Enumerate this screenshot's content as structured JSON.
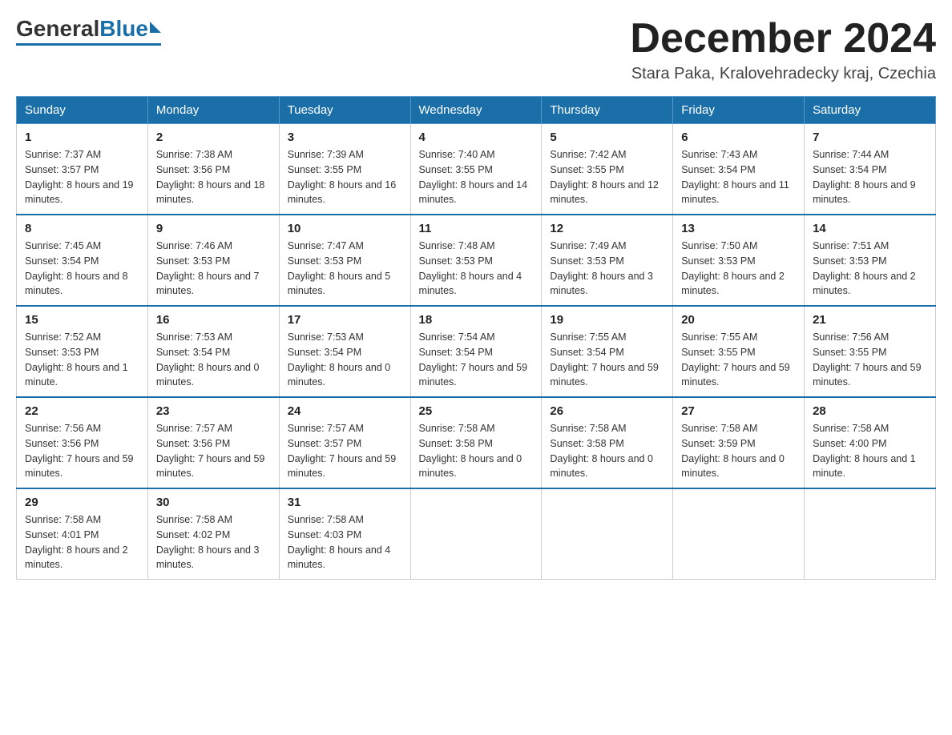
{
  "logo": {
    "general": "General",
    "blue": "Blue"
  },
  "title": {
    "month_year": "December 2024",
    "location": "Stara Paka, Kralovehradecky kraj, Czechia"
  },
  "headers": [
    "Sunday",
    "Monday",
    "Tuesday",
    "Wednesday",
    "Thursday",
    "Friday",
    "Saturday"
  ],
  "weeks": [
    [
      {
        "day": "1",
        "sunrise": "7:37 AM",
        "sunset": "3:57 PM",
        "daylight": "8 hours and 19 minutes."
      },
      {
        "day": "2",
        "sunrise": "7:38 AM",
        "sunset": "3:56 PM",
        "daylight": "8 hours and 18 minutes."
      },
      {
        "day": "3",
        "sunrise": "7:39 AM",
        "sunset": "3:55 PM",
        "daylight": "8 hours and 16 minutes."
      },
      {
        "day": "4",
        "sunrise": "7:40 AM",
        "sunset": "3:55 PM",
        "daylight": "8 hours and 14 minutes."
      },
      {
        "day": "5",
        "sunrise": "7:42 AM",
        "sunset": "3:55 PM",
        "daylight": "8 hours and 12 minutes."
      },
      {
        "day": "6",
        "sunrise": "7:43 AM",
        "sunset": "3:54 PM",
        "daylight": "8 hours and 11 minutes."
      },
      {
        "day": "7",
        "sunrise": "7:44 AM",
        "sunset": "3:54 PM",
        "daylight": "8 hours and 9 minutes."
      }
    ],
    [
      {
        "day": "8",
        "sunrise": "7:45 AM",
        "sunset": "3:54 PM",
        "daylight": "8 hours and 8 minutes."
      },
      {
        "day": "9",
        "sunrise": "7:46 AM",
        "sunset": "3:53 PM",
        "daylight": "8 hours and 7 minutes."
      },
      {
        "day": "10",
        "sunrise": "7:47 AM",
        "sunset": "3:53 PM",
        "daylight": "8 hours and 5 minutes."
      },
      {
        "day": "11",
        "sunrise": "7:48 AM",
        "sunset": "3:53 PM",
        "daylight": "8 hours and 4 minutes."
      },
      {
        "day": "12",
        "sunrise": "7:49 AM",
        "sunset": "3:53 PM",
        "daylight": "8 hours and 3 minutes."
      },
      {
        "day": "13",
        "sunrise": "7:50 AM",
        "sunset": "3:53 PM",
        "daylight": "8 hours and 2 minutes."
      },
      {
        "day": "14",
        "sunrise": "7:51 AM",
        "sunset": "3:53 PM",
        "daylight": "8 hours and 2 minutes."
      }
    ],
    [
      {
        "day": "15",
        "sunrise": "7:52 AM",
        "sunset": "3:53 PM",
        "daylight": "8 hours and 1 minute."
      },
      {
        "day": "16",
        "sunrise": "7:53 AM",
        "sunset": "3:54 PM",
        "daylight": "8 hours and 0 minutes."
      },
      {
        "day": "17",
        "sunrise": "7:53 AM",
        "sunset": "3:54 PM",
        "daylight": "8 hours and 0 minutes."
      },
      {
        "day": "18",
        "sunrise": "7:54 AM",
        "sunset": "3:54 PM",
        "daylight": "7 hours and 59 minutes."
      },
      {
        "day": "19",
        "sunrise": "7:55 AM",
        "sunset": "3:54 PM",
        "daylight": "7 hours and 59 minutes."
      },
      {
        "day": "20",
        "sunrise": "7:55 AM",
        "sunset": "3:55 PM",
        "daylight": "7 hours and 59 minutes."
      },
      {
        "day": "21",
        "sunrise": "7:56 AM",
        "sunset": "3:55 PM",
        "daylight": "7 hours and 59 minutes."
      }
    ],
    [
      {
        "day": "22",
        "sunrise": "7:56 AM",
        "sunset": "3:56 PM",
        "daylight": "7 hours and 59 minutes."
      },
      {
        "day": "23",
        "sunrise": "7:57 AM",
        "sunset": "3:56 PM",
        "daylight": "7 hours and 59 minutes."
      },
      {
        "day": "24",
        "sunrise": "7:57 AM",
        "sunset": "3:57 PM",
        "daylight": "7 hours and 59 minutes."
      },
      {
        "day": "25",
        "sunrise": "7:58 AM",
        "sunset": "3:58 PM",
        "daylight": "8 hours and 0 minutes."
      },
      {
        "day": "26",
        "sunrise": "7:58 AM",
        "sunset": "3:58 PM",
        "daylight": "8 hours and 0 minutes."
      },
      {
        "day": "27",
        "sunrise": "7:58 AM",
        "sunset": "3:59 PM",
        "daylight": "8 hours and 0 minutes."
      },
      {
        "day": "28",
        "sunrise": "7:58 AM",
        "sunset": "4:00 PM",
        "daylight": "8 hours and 1 minute."
      }
    ],
    [
      {
        "day": "29",
        "sunrise": "7:58 AM",
        "sunset": "4:01 PM",
        "daylight": "8 hours and 2 minutes."
      },
      {
        "day": "30",
        "sunrise": "7:58 AM",
        "sunset": "4:02 PM",
        "daylight": "8 hours and 3 minutes."
      },
      {
        "day": "31",
        "sunrise": "7:58 AM",
        "sunset": "4:03 PM",
        "daylight": "8 hours and 4 minutes."
      },
      null,
      null,
      null,
      null
    ]
  ],
  "labels": {
    "sunrise": "Sunrise:",
    "sunset": "Sunset:",
    "daylight": "Daylight:"
  }
}
